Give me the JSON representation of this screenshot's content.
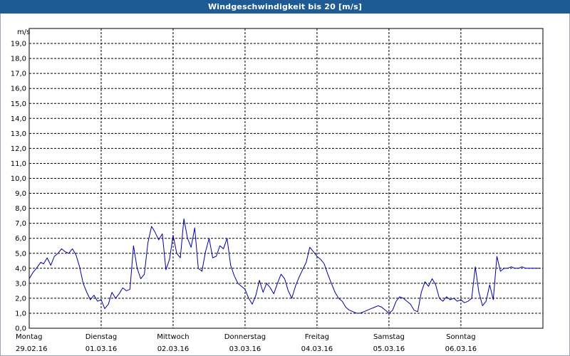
{
  "window": {
    "title": "Windgeschwindigkeit bis 20 [m/s]"
  },
  "colors": {
    "title_bar": "#1e5a94",
    "series": "#0000a0",
    "grid": "#000000"
  },
  "chart_data": {
    "type": "line",
    "title": "Windgeschwindigkeit bis 20 [m/s]",
    "ylabel": "m/s",
    "ylim": [
      0,
      20
    ],
    "y_ticks": [
      "0,0",
      "1,0",
      "2,0",
      "3,0",
      "4,0",
      "5,0",
      "6,0",
      "7,0",
      "8,0",
      "9,0",
      "10,0",
      "11,0",
      "12,0",
      "13,0",
      "14,0",
      "15,0",
      "16,0",
      "17,0",
      "18,0",
      "19,0"
    ],
    "xlim": [
      0,
      7.14
    ],
    "grid": true,
    "x_ticks": [
      {
        "day": "Montag",
        "date": "29.02.16"
      },
      {
        "day": "Dienstag",
        "date": "01.03.16"
      },
      {
        "day": "Mittwoch",
        "date": "02.03.16"
      },
      {
        "day": "Donnerstag",
        "date": "03.03.16"
      },
      {
        "day": "Freitag",
        "date": "04.03.16"
      },
      {
        "day": "Samstag",
        "date": "05.03.16"
      },
      {
        "day": "Sonntag",
        "date": "06.03.16"
      }
    ],
    "series": [
      {
        "x": [
          0.0,
          0.05,
          0.1,
          0.16,
          0.2,
          0.25,
          0.3,
          0.35,
          0.4,
          0.45,
          0.5,
          0.55,
          0.6,
          0.65,
          0.7,
          0.75,
          0.8,
          0.85,
          0.9,
          0.95,
          1.0,
          1.05,
          1.1,
          1.15,
          1.2,
          1.25,
          1.3,
          1.35,
          1.4,
          1.45,
          1.5,
          1.55,
          1.6,
          1.65,
          1.7,
          1.75,
          1.8,
          1.85,
          1.9,
          1.95,
          2.0,
          2.05,
          2.1,
          2.15,
          2.2,
          2.25,
          2.3,
          2.35,
          2.4,
          2.45,
          2.5,
          2.55,
          2.6,
          2.65,
          2.7,
          2.75,
          2.8,
          2.85,
          2.9,
          2.95,
          3.0,
          3.05,
          3.1,
          3.15,
          3.2,
          3.25,
          3.3,
          3.35,
          3.4,
          3.45,
          3.5,
          3.55,
          3.6,
          3.65,
          3.7,
          3.75,
          3.8,
          3.85,
          3.9,
          3.95,
          4.0,
          4.05,
          4.1,
          4.15,
          4.2,
          4.25,
          4.3,
          4.35,
          4.4,
          4.45,
          4.5,
          4.55,
          4.6,
          4.65,
          4.7,
          4.75,
          4.8,
          4.85,
          4.9,
          4.95,
          5.0,
          5.05,
          5.1,
          5.15,
          5.2,
          5.25,
          5.3,
          5.35,
          5.4,
          5.45,
          5.5,
          5.55,
          5.6,
          5.65,
          5.7,
          5.75,
          5.8,
          5.85,
          5.9,
          5.95,
          6.0,
          6.05,
          6.1,
          6.15,
          6.2,
          6.25,
          6.3,
          6.35,
          6.4,
          6.45,
          6.5,
          6.55,
          6.6,
          6.65,
          6.7,
          6.75,
          6.8,
          6.85,
          6.9,
          6.95,
          7.0,
          7.05,
          7.1
        ],
        "values": [
          3.3,
          3.7,
          4.0,
          4.4,
          4.3,
          4.7,
          4.2,
          4.8,
          5.0,
          5.3,
          5.1,
          5.0,
          5.3,
          4.9,
          4.1,
          3.0,
          2.4,
          1.9,
          2.2,
          1.8,
          1.9,
          1.3,
          1.6,
          2.4,
          2.0,
          2.3,
          2.7,
          2.5,
          2.6,
          5.5,
          4.0,
          3.3,
          3.6,
          5.7,
          6.8,
          6.4,
          5.9,
          6.3,
          3.9,
          4.6,
          6.2,
          5.0,
          4.7,
          7.3,
          6.0,
          5.4,
          6.7,
          4.0,
          3.8,
          5.1,
          6.0,
          4.7,
          4.8,
          5.5,
          5.3,
          6.0,
          4.2,
          3.5,
          3.0,
          2.8,
          2.6,
          2.0,
          1.6,
          2.2,
          3.2,
          2.4,
          3.0,
          2.7,
          2.3,
          3.0,
          3.6,
          3.3,
          2.5,
          2.0,
          2.8,
          3.4,
          3.9,
          4.4,
          5.4,
          5.1,
          4.8,
          4.6,
          4.3,
          3.6,
          3.0,
          2.4,
          2.0,
          1.8,
          1.4,
          1.2,
          1.1,
          1.0,
          1.0,
          1.1,
          1.2,
          1.3,
          1.4,
          1.5,
          1.4,
          1.2,
          1.0,
          1.2,
          1.8,
          2.1,
          2.0,
          1.8,
          1.6,
          1.2,
          1.1,
          2.4,
          3.1,
          2.8,
          3.3,
          2.9,
          2.0,
          1.8,
          2.1,
          1.9,
          2.0,
          1.8,
          1.9,
          1.7,
          1.8,
          2.0,
          4.1,
          2.4,
          1.5,
          1.8,
          2.9,
          1.9,
          4.8,
          3.8,
          4.0,
          4.0,
          4.1,
          4.0,
          4.0,
          4.1,
          4.0,
          4.0,
          4.0,
          4.0,
          4.0
        ]
      }
    ]
  }
}
